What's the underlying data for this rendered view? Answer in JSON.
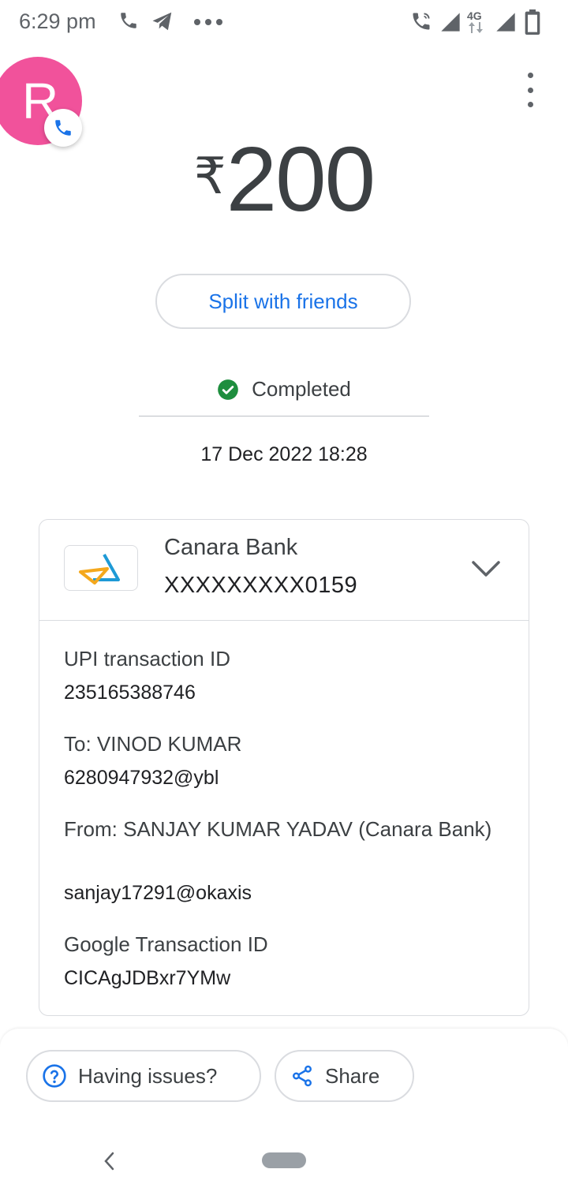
{
  "status_bar": {
    "time": "6:29 pm",
    "network": "4G"
  },
  "contact": {
    "avatar_letter": "R"
  },
  "payment": {
    "currency_symbol": "₹",
    "amount": "200"
  },
  "actions": {
    "split_label": "Split with friends"
  },
  "status": {
    "label": "Completed",
    "datetime": "17 Dec 2022 18:28",
    "color": "#1e8e3e"
  },
  "bank": {
    "name": "Canara Bank",
    "account": "XXXXXXXXX0159"
  },
  "details": {
    "upi_label": "UPI transaction ID",
    "upi_value": "235165388746",
    "to_label": "To: VINOD KUMAR",
    "to_value": "6280947932@ybl",
    "from_label": "From: SANJAY KUMAR YADAV (Canara Bank)",
    "from_value": "sanjay17291@okaxis",
    "google_label": "Google Transaction ID",
    "google_value": "CICAgJDBxr7YMw"
  },
  "footer": {
    "issues_label": "Having issues?",
    "share_label": "Share"
  },
  "colors": {
    "accent": "#1a73e8",
    "avatar": "#f1529b"
  }
}
